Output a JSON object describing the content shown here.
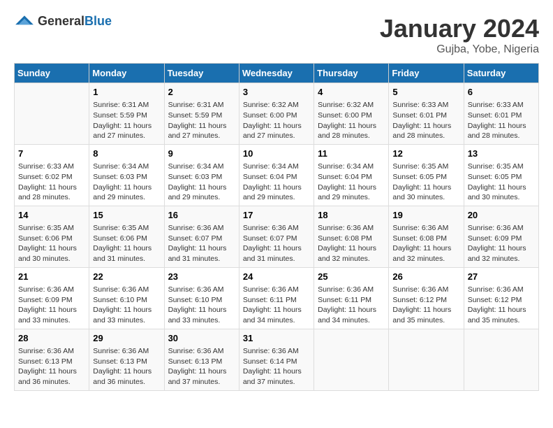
{
  "logo": {
    "general": "General",
    "blue": "Blue"
  },
  "title": "January 2024",
  "subtitle": "Gujba, Yobe, Nigeria",
  "headers": [
    "Sunday",
    "Monday",
    "Tuesday",
    "Wednesday",
    "Thursday",
    "Friday",
    "Saturday"
  ],
  "weeks": [
    [
      {
        "day": "",
        "info": ""
      },
      {
        "day": "1",
        "info": "Sunrise: 6:31 AM\nSunset: 5:59 PM\nDaylight: 11 hours and 27 minutes."
      },
      {
        "day": "2",
        "info": "Sunrise: 6:31 AM\nSunset: 5:59 PM\nDaylight: 11 hours and 27 minutes."
      },
      {
        "day": "3",
        "info": "Sunrise: 6:32 AM\nSunset: 6:00 PM\nDaylight: 11 hours and 27 minutes."
      },
      {
        "day": "4",
        "info": "Sunrise: 6:32 AM\nSunset: 6:00 PM\nDaylight: 11 hours and 28 minutes."
      },
      {
        "day": "5",
        "info": "Sunrise: 6:33 AM\nSunset: 6:01 PM\nDaylight: 11 hours and 28 minutes."
      },
      {
        "day": "6",
        "info": "Sunrise: 6:33 AM\nSunset: 6:01 PM\nDaylight: 11 hours and 28 minutes."
      }
    ],
    [
      {
        "day": "7",
        "info": "Sunrise: 6:33 AM\nSunset: 6:02 PM\nDaylight: 11 hours and 28 minutes."
      },
      {
        "day": "8",
        "info": "Sunrise: 6:34 AM\nSunset: 6:03 PM\nDaylight: 11 hours and 29 minutes."
      },
      {
        "day": "9",
        "info": "Sunrise: 6:34 AM\nSunset: 6:03 PM\nDaylight: 11 hours and 29 minutes."
      },
      {
        "day": "10",
        "info": "Sunrise: 6:34 AM\nSunset: 6:04 PM\nDaylight: 11 hours and 29 minutes."
      },
      {
        "day": "11",
        "info": "Sunrise: 6:34 AM\nSunset: 6:04 PM\nDaylight: 11 hours and 29 minutes."
      },
      {
        "day": "12",
        "info": "Sunrise: 6:35 AM\nSunset: 6:05 PM\nDaylight: 11 hours and 30 minutes."
      },
      {
        "day": "13",
        "info": "Sunrise: 6:35 AM\nSunset: 6:05 PM\nDaylight: 11 hours and 30 minutes."
      }
    ],
    [
      {
        "day": "14",
        "info": "Sunrise: 6:35 AM\nSunset: 6:06 PM\nDaylight: 11 hours and 30 minutes."
      },
      {
        "day": "15",
        "info": "Sunrise: 6:35 AM\nSunset: 6:06 PM\nDaylight: 11 hours and 31 minutes."
      },
      {
        "day": "16",
        "info": "Sunrise: 6:36 AM\nSunset: 6:07 PM\nDaylight: 11 hours and 31 minutes."
      },
      {
        "day": "17",
        "info": "Sunrise: 6:36 AM\nSunset: 6:07 PM\nDaylight: 11 hours and 31 minutes."
      },
      {
        "day": "18",
        "info": "Sunrise: 6:36 AM\nSunset: 6:08 PM\nDaylight: 11 hours and 32 minutes."
      },
      {
        "day": "19",
        "info": "Sunrise: 6:36 AM\nSunset: 6:08 PM\nDaylight: 11 hours and 32 minutes."
      },
      {
        "day": "20",
        "info": "Sunrise: 6:36 AM\nSunset: 6:09 PM\nDaylight: 11 hours and 32 minutes."
      }
    ],
    [
      {
        "day": "21",
        "info": "Sunrise: 6:36 AM\nSunset: 6:09 PM\nDaylight: 11 hours and 33 minutes."
      },
      {
        "day": "22",
        "info": "Sunrise: 6:36 AM\nSunset: 6:10 PM\nDaylight: 11 hours and 33 minutes."
      },
      {
        "day": "23",
        "info": "Sunrise: 6:36 AM\nSunset: 6:10 PM\nDaylight: 11 hours and 33 minutes."
      },
      {
        "day": "24",
        "info": "Sunrise: 6:36 AM\nSunset: 6:11 PM\nDaylight: 11 hours and 34 minutes."
      },
      {
        "day": "25",
        "info": "Sunrise: 6:36 AM\nSunset: 6:11 PM\nDaylight: 11 hours and 34 minutes."
      },
      {
        "day": "26",
        "info": "Sunrise: 6:36 AM\nSunset: 6:12 PM\nDaylight: 11 hours and 35 minutes."
      },
      {
        "day": "27",
        "info": "Sunrise: 6:36 AM\nSunset: 6:12 PM\nDaylight: 11 hours and 35 minutes."
      }
    ],
    [
      {
        "day": "28",
        "info": "Sunrise: 6:36 AM\nSunset: 6:13 PM\nDaylight: 11 hours and 36 minutes."
      },
      {
        "day": "29",
        "info": "Sunrise: 6:36 AM\nSunset: 6:13 PM\nDaylight: 11 hours and 36 minutes."
      },
      {
        "day": "30",
        "info": "Sunrise: 6:36 AM\nSunset: 6:13 PM\nDaylight: 11 hours and 37 minutes."
      },
      {
        "day": "31",
        "info": "Sunrise: 6:36 AM\nSunset: 6:14 PM\nDaylight: 11 hours and 37 minutes."
      },
      {
        "day": "",
        "info": ""
      },
      {
        "day": "",
        "info": ""
      },
      {
        "day": "",
        "info": ""
      }
    ]
  ]
}
